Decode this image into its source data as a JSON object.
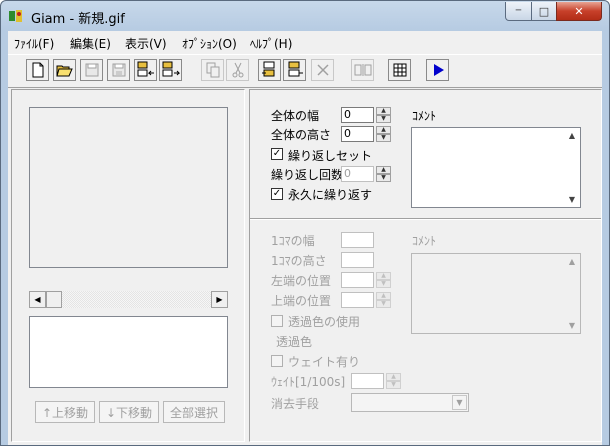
{
  "window": {
    "title": "Giam - 新規.gif",
    "minimize_glyph": "─",
    "maximize_glyph": "□",
    "close_glyph": "✕"
  },
  "menu": [
    "ﾌｧｲﾙ(F)",
    "編集(E)",
    "表示(V)",
    "ｵﾌﾟｼｮﾝ(O)",
    "ﾍﾙﾌﾟ(H)"
  ],
  "toolbar": {
    "icons": [
      "new-file-icon",
      "open-folder-icon",
      "save-icon",
      "save-as-icon",
      "import-icon",
      "export-icon",
      "copy-icon",
      "cut-icon",
      "paste-before-icon",
      "paste-after-icon",
      "delete-icon",
      "insert-frame-icon",
      "grid-icon",
      "play-icon"
    ]
  },
  "left": {
    "hscroll_left": "◀",
    "hscroll_right": "▶",
    "move_up_label": "↑上移動",
    "move_down_label": "↓下移動",
    "select_all_label": "全部選択"
  },
  "global": {
    "width_label": "全体の幅",
    "width_value": "0",
    "height_label": "全体の高さ",
    "height_value": "0",
    "loop_set_label": "繰り返しセット",
    "loop_set_checked": true,
    "loop_count_label": "繰り返し回数",
    "loop_count_value": "0",
    "loop_forever_label": "永久に繰り返す",
    "loop_forever_checked": true,
    "comment_label": "ｺﾒﾝﾄ",
    "comment_value": ""
  },
  "frame": {
    "frame_width_label": "1ｺﾏの幅",
    "frame_height_label": "1ｺﾏの高さ",
    "left_pos_label": "左端の位置",
    "top_pos_label": "上端の位置",
    "use_transparent_label": "透過色の使用",
    "transparent_color_label": "透過色",
    "wait_label": "ウェイト有り",
    "wait_value_label": "ｳｪｲﾄ[1/100s]",
    "dispose_label": "消去手段",
    "comment_label": "ｺﾒﾝﾄ"
  },
  "colors": {
    "play_icon": "#0000cc",
    "window_frame": "#b6cbe2",
    "close_button": "#c7402a"
  }
}
